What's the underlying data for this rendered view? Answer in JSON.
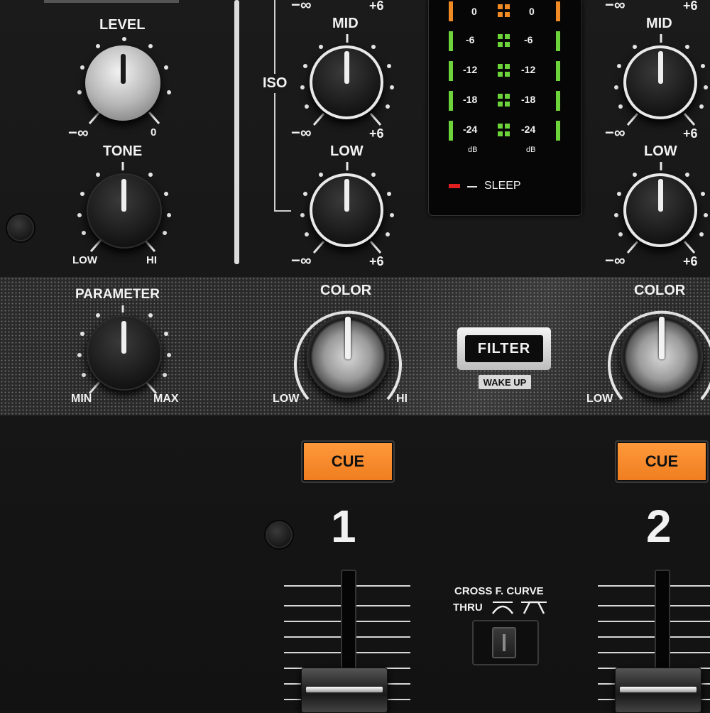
{
  "channel_left": {
    "level_label": "LEVEL",
    "level_min": "−∞",
    "level_max": "0",
    "tone_label": "TONE",
    "tone_min": "LOW",
    "tone_max": "HI"
  },
  "eq_ch1": {
    "top_min": "−∞",
    "top_max": "+6",
    "mid_label": "MID",
    "mid_min": "−∞",
    "mid_max": "+6",
    "low_label": "LOW",
    "low_min": "−∞",
    "low_max": "+6",
    "iso_label": "ISO"
  },
  "eq_ch2": {
    "top_min": "−∞",
    "top_max": "+6",
    "mid_label": "MID",
    "mid_min": "−∞",
    "mid_max": "+6",
    "low_label": "LOW",
    "low_min": "−∞",
    "low_max": "+6"
  },
  "meter": {
    "scale": [
      "0",
      "-6",
      "-12",
      "-18",
      "-24"
    ],
    "unit_left": "dB",
    "unit_right": "dB",
    "sleep_label": "SLEEP",
    "colors": {
      "orange": "#f08a24",
      "green": "#6cd33a",
      "red": "#e02020"
    }
  },
  "effects_strip": {
    "parameter_label": "PARAMETER",
    "parameter_min": "MIN",
    "parameter_max": "MAX",
    "color_label_1": "COLOR",
    "color_min_1": "LOW",
    "color_max_1": "HI",
    "filter_label": "FILTER",
    "wake_up_label": "WAKE UP",
    "color_label_2": "COLOR",
    "color_min_2": "LOW"
  },
  "channels": {
    "cue_label_1": "CUE",
    "cue_label_2": "CUE",
    "number_1": "1",
    "number_2": "2"
  },
  "crossfader": {
    "curve_label": "CROSS F. CURVE",
    "thru_label": "THRU"
  }
}
